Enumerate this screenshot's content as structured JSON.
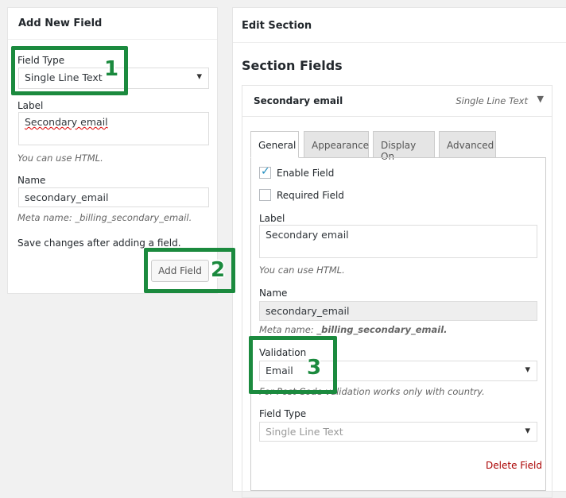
{
  "add_panel": {
    "title": "Add New Field",
    "field_type_label": "Field Type",
    "field_type_value": "Single Line Text",
    "label_label": "Label",
    "label_value": "Secondary email",
    "html_hint": "You can use HTML.",
    "name_label": "Name",
    "name_value": "secondary_email",
    "meta_prefix": "Meta name: ",
    "meta_value": "_billing_secondary_email.",
    "save_hint": "Save changes after adding a field.",
    "add_button": "Add Field"
  },
  "edit_panel": {
    "title": "Edit Section",
    "section_fields": "Section Fields",
    "field_title": "Secondary email",
    "field_type_badge": "Single Line Text",
    "tabs": [
      {
        "label": "General",
        "active": true
      },
      {
        "label": "Appearance"
      },
      {
        "label": "Display On"
      },
      {
        "label": "Advanced"
      }
    ],
    "enable_field": {
      "label": "Enable Field",
      "checked": true
    },
    "required_field": {
      "label": "Required Field",
      "checked": false
    },
    "label_label": "Label",
    "label_value": "Secondary email",
    "html_hint": "You can use HTML.",
    "name_label": "Name",
    "name_value": "secondary_email",
    "meta_prefix": "Meta name: ",
    "meta_value": "_billing_secondary_email.",
    "validation_label": "Validation",
    "validation_value": "Email",
    "validation_hint": "For Post Code validation works only with country.",
    "field_type_label": "Field Type",
    "field_type_value": "Single Line Text",
    "delete_link": "Delete Field"
  },
  "annotations": {
    "n1": "1",
    "n2": "2",
    "n3": "3",
    "color": "#1b8a3e"
  }
}
